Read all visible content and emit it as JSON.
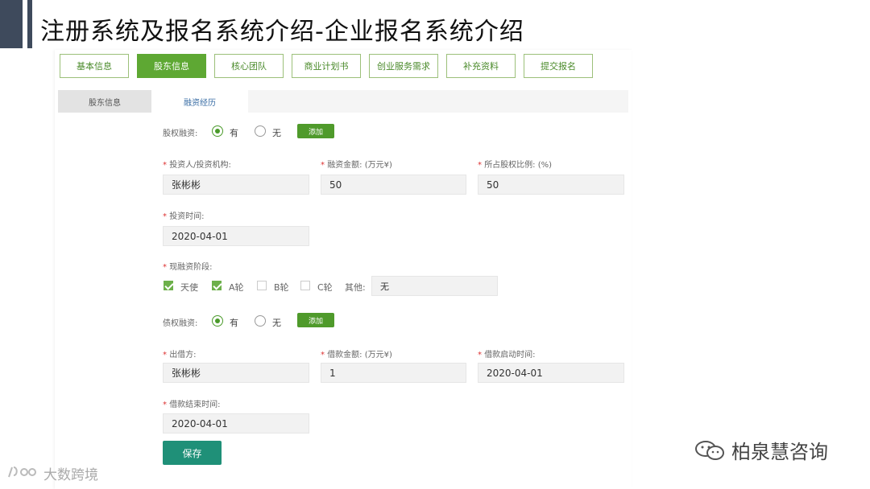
{
  "slide": {
    "title": "注册系统及报名系统介绍-企业报名系统介绍"
  },
  "top_tabs": [
    {
      "label": "基本信息",
      "active": false
    },
    {
      "label": "股东信息",
      "active": true
    },
    {
      "label": "核心团队",
      "active": false
    },
    {
      "label": "商业计划书",
      "active": false
    },
    {
      "label": "创业服务需求",
      "active": false
    },
    {
      "label": "补充资料",
      "active": false
    },
    {
      "label": "提交报名",
      "active": false
    }
  ],
  "sub_tabs": [
    {
      "label": "股东信息",
      "active": true
    },
    {
      "label": "融资经历",
      "active": false
    }
  ],
  "equity": {
    "label": "股权融资:",
    "yes": "有",
    "no": "无",
    "selected": "yes",
    "add": "添加",
    "investor_label": "投资人/投资机构:",
    "investor_value": "张彬彬",
    "amount_label": "融资金额: (万元¥)",
    "amount_value": "50",
    "ratio_label": "所占股权比例: (%)",
    "ratio_value": "50",
    "time_label": "投资时间:",
    "time_value": "2020-04-01",
    "stage_label": "现融资阶段:",
    "stages": [
      {
        "label": "天使",
        "checked": true
      },
      {
        "label": "A轮",
        "checked": true
      },
      {
        "label": "B轮",
        "checked": false
      },
      {
        "label": "C轮",
        "checked": false
      }
    ],
    "other_label": "其他:",
    "other_value": "无"
  },
  "debt": {
    "label": "债权融资:",
    "yes": "有",
    "no": "无",
    "selected": "yes",
    "add": "添加",
    "lender_label": "出借方:",
    "lender_value": "张彬彬",
    "amount_label": "借款金额: (万元¥)",
    "amount_value": "1",
    "start_label": "借款启动时间:",
    "start_value": "2020-04-01",
    "end_label": "借款结束时间:",
    "end_value": "2020-04-01"
  },
  "save_label": "保存",
  "watermark_left": "大数跨境",
  "watermark_right": "柏泉慧咨询",
  "colors": {
    "primary_green": "#5ea833",
    "save_teal": "#1f9078",
    "title_bar": "#3e4a5c"
  }
}
